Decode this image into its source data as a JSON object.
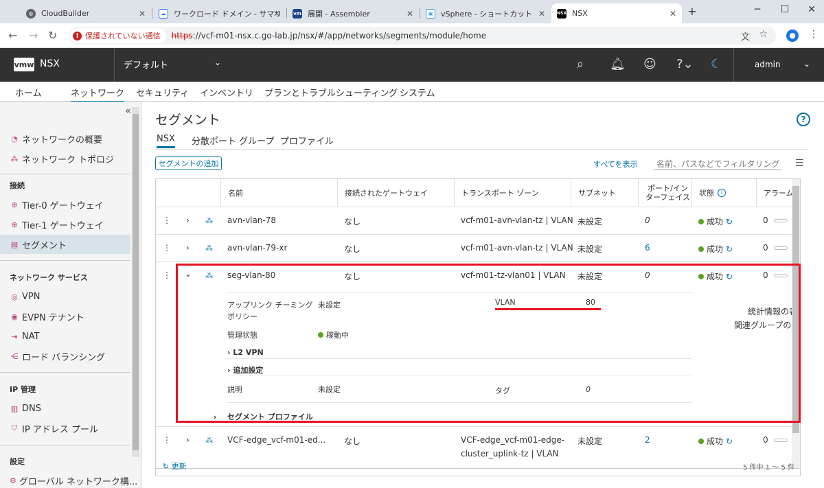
{
  "browser": {
    "tabs": [
      {
        "title": "CloudBuilder",
        "icon": "globe-icon"
      },
      {
        "title": "ワークロード ドメイン - サマリ",
        "icon": "cloud-icon"
      },
      {
        "title": "展開 - Assembler",
        "icon": "vmw-icon"
      },
      {
        "title": "vSphere - ショートカット",
        "icon": "vsphere-icon"
      },
      {
        "title": "NSX",
        "icon": "nsx-icon"
      }
    ],
    "security_chip": "保護されていない通信",
    "url_scheme": "https",
    "url_rest": "://vcf-m01-nsx.c.go-lab.jp/nsx/#/app/networks/segments/module/home"
  },
  "header": {
    "logo": "vmw",
    "product": "NSX",
    "context": "デフォルト",
    "user": "admin"
  },
  "main_nav": [
    "ホーム",
    "ネットワーク",
    "セキュリティ",
    "インベントリ",
    "プランとトラブルシューティング",
    "システム"
  ],
  "sidebar": {
    "top_items": [
      "ネットワークの概要",
      "ネットワーク トポロジ"
    ],
    "sections": [
      {
        "title": "接続",
        "items": [
          "Tier-0 ゲートウェイ",
          "Tier-1 ゲートウェイ",
          "セグメント"
        ]
      },
      {
        "title": "ネットワーク サービス",
        "items": [
          "VPN",
          "EVPN テナント",
          "NAT",
          "ロード バランシング"
        ]
      },
      {
        "title": "IP 管理",
        "items": [
          "DNS",
          "IP アドレス プール"
        ]
      },
      {
        "title": "設定",
        "items": [
          "グローバル ネットワーク構..."
        ]
      }
    ]
  },
  "page": {
    "title": "セグメント",
    "tabs": [
      "NSX",
      "分散ポート グループ",
      "プロファイル"
    ],
    "add_button": "セグメントの追加",
    "show_all": "すべてを表示",
    "filter_placeholder": "名前、パスなどでフィルタリング",
    "refresh": "更新",
    "pagination": "5 件中 1 ～ 5 件"
  },
  "grid": {
    "headers": [
      "名前",
      "接続されたゲートウェイ",
      "トランスポート ゾーン",
      "サブネット",
      "ポート/イン ターフェイス",
      "状態",
      "アラーム"
    ],
    "rows": [
      {
        "name": "avn-vlan-78",
        "gateway": "なし",
        "tz": "vcf-m01-avn-vlan-tz | VLAN",
        "subnet": "未設定",
        "ports": "0",
        "status": "成功",
        "alarm": "0"
      },
      {
        "name": "avn-vlan-79-xr",
        "gateway": "なし",
        "tz": "vcf-m01-avn-vlan-tz | VLAN",
        "subnet": "未設定",
        "ports": "6",
        "status": "成功",
        "alarm": "0"
      },
      {
        "name": "seg-vlan-80",
        "gateway": "なし",
        "tz": "vcf-m01-tz-vlan01 | VLAN",
        "subnet": "未設定",
        "ports": "0",
        "status": "成功",
        "alarm": "0"
      },
      {
        "name": "VCF-edge_vcf-m01-ed...",
        "gateway": "なし",
        "tz": "VCF-edge_vcf-m01-edge-",
        "tz2": "cluster_uplink-tz | VLAN",
        "subnet": "未設定",
        "ports": "2",
        "status": "成功",
        "alarm": "0"
      }
    ],
    "detail": {
      "teaming_label": "アップリンク チーミング",
      "teaming_label2": "ポリシー",
      "teaming_value": "未設定",
      "vlan_label": "VLAN",
      "vlan_value": "80",
      "stats_link": "統計情報の表示",
      "groups_link": "関連グループの表示",
      "admin_label": "管理状態",
      "admin_value": "稼動中",
      "l2vpn": "L2 VPN",
      "additional": "追加設定",
      "desc_label": "説明",
      "desc_value": "未設定",
      "tag_label": "タグ",
      "tag_value": "0",
      "profile": "セグメント プロファイル"
    }
  },
  "colors": {
    "accent": "#0072a3",
    "success": "#5aa220",
    "highlight": "#e81123",
    "header_bg": "#313131"
  }
}
